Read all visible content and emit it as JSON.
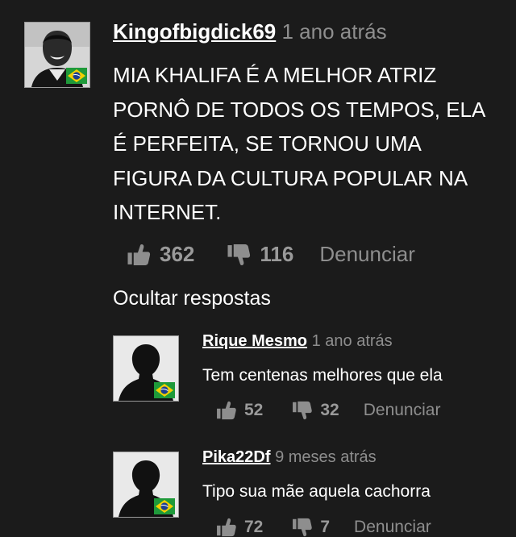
{
  "main_comment": {
    "username": "Kingofbigdick69",
    "time": "1 ano atrás",
    "text": "MIA KHALIFA É A MELHOR ATRIZ PORNÔ DE TODOS OS TEMPOS, ELA É PERFEITA, SE TORNOU UMA FIGURA DA CULTURA POPULAR NA INTERNET.",
    "likes": "362",
    "dislikes": "116",
    "report_label": "Denunciar"
  },
  "hide_replies_label": "Ocultar respostas",
  "replies": [
    {
      "username": "Rique Mesmo",
      "time": "1 ano atrás",
      "text": "Tem centenas melhores que ela",
      "likes": "52",
      "dislikes": "32",
      "report_label": "Denunciar"
    },
    {
      "username": "Pika22Df",
      "time": "9 meses atrás",
      "text": "Tipo sua mãe aquela cachorra",
      "likes": "72",
      "dislikes": "7",
      "report_label": "Denunciar"
    }
  ],
  "colors": {
    "background": "#1b1b1b",
    "text": "#ffffff",
    "muted": "#8e8e8e",
    "flag_green": "#1f9a3a",
    "flag_yellow": "#f4d000",
    "flag_blue": "#1d3f8f"
  },
  "icons": [
    "thumbs-up-icon",
    "thumbs-down-icon",
    "brazil-flag-icon",
    "avatar-photo",
    "avatar-silhouette"
  ]
}
